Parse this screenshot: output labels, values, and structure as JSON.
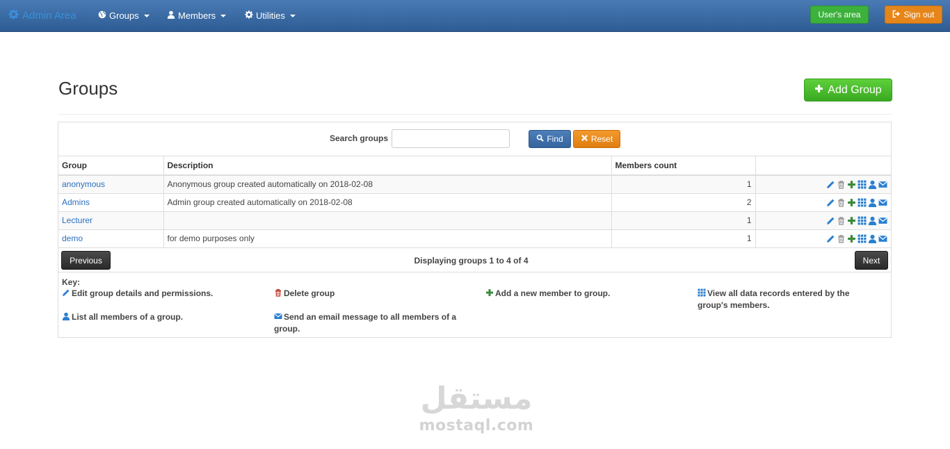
{
  "navbar": {
    "brand": "Admin Area",
    "menus": [
      {
        "label": "Groups",
        "icon": "globe-icon"
      },
      {
        "label": "Members",
        "icon": "user-icon"
      },
      {
        "label": "Utilities",
        "icon": "cog-icon"
      }
    ],
    "users_area_label": "User's area",
    "sign_out_label": "Sign out"
  },
  "page": {
    "title": "Groups",
    "add_group_label": "Add Group"
  },
  "search": {
    "label": "Search groups",
    "value": "",
    "find_label": "Find",
    "reset_label": "Reset"
  },
  "table": {
    "columns": [
      "Group",
      "Description",
      "Members count",
      ""
    ],
    "rows": [
      {
        "group": "anonymous",
        "description": "Anonymous group created automatically on 2018-02-08",
        "members": "1"
      },
      {
        "group": "Admins",
        "description": "Admin group created automatically on 2018-02-08",
        "members": "2"
      },
      {
        "group": "Lecturer",
        "description": "",
        "members": "1"
      },
      {
        "group": "demo",
        "description": "for demo purposes only",
        "members": "1"
      }
    ]
  },
  "pager": {
    "previous_label": "Previous",
    "info": "Displaying groups 1 to 4 of 4",
    "next_label": "Next"
  },
  "key": {
    "title": "Key:",
    "edit": "Edit group details and permissions.",
    "delete": "Delete group",
    "add_member": "Add a new member to group.",
    "view_records": "View all data records entered by the group's members.",
    "list_members": "List all members of a group.",
    "email": "Send an email message to all members of a group."
  },
  "watermark": {
    "arabic": "مستقل",
    "latin": "mostaql.com"
  },
  "colors": {
    "navbar": "#3a6aa5",
    "link": "#2a6fc0",
    "success": "#3cb13c",
    "warning": "#e6861a",
    "primary": "#34649e",
    "dark": "#333333",
    "edit_icon": "#2a7fd0",
    "delete_icon": "#999999",
    "add_icon": "#3c8a3c",
    "records_icon": "#2a7fd0",
    "members_icon": "#2a7fd0",
    "email_icon": "#2a7fd0"
  }
}
